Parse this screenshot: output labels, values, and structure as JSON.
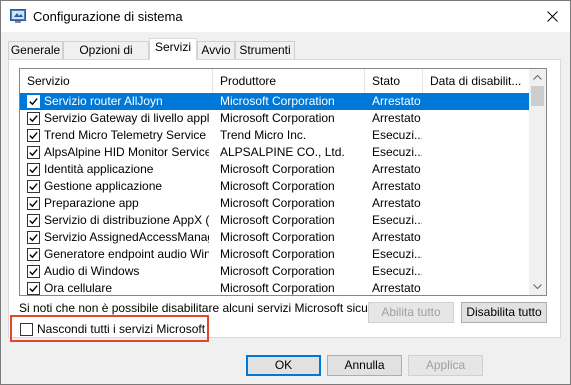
{
  "window": {
    "title": "Configurazione di sistema"
  },
  "tabs": [
    {
      "label": "Generale",
      "active": false
    },
    {
      "label": "Opzioni di avvio",
      "active": false
    },
    {
      "label": "Servizi",
      "active": true
    },
    {
      "label": "Avvio",
      "active": false
    },
    {
      "label": "Strumenti",
      "active": false
    }
  ],
  "table": {
    "columns": [
      "Servizio",
      "Produttore",
      "Stato",
      "Data di disabilit..."
    ],
    "rows": [
      {
        "checked": true,
        "service": "Servizio router AllJoyn",
        "vendor": "Microsoft Corporation",
        "status": "Arrestato",
        "date": "",
        "selected": true
      },
      {
        "checked": true,
        "service": "Servizio Gateway di livello applic...",
        "vendor": "Microsoft Corporation",
        "status": "Arrestato",
        "date": ""
      },
      {
        "checked": true,
        "service": "Trend Micro Telemetry Service",
        "vendor": "Trend Micro Inc.",
        "status": "Esecuzi...",
        "date": ""
      },
      {
        "checked": true,
        "service": "AlpsAlpine HID Monitor Service",
        "vendor": "ALPSALPINE CO., Ltd.",
        "status": "Esecuzi...",
        "date": ""
      },
      {
        "checked": true,
        "service": "Identità applicazione",
        "vendor": "Microsoft Corporation",
        "status": "Arrestato",
        "date": ""
      },
      {
        "checked": true,
        "service": "Gestione applicazione",
        "vendor": "Microsoft Corporation",
        "status": "Arrestato",
        "date": ""
      },
      {
        "checked": true,
        "service": "Preparazione app",
        "vendor": "Microsoft Corporation",
        "status": "Arrestato",
        "date": ""
      },
      {
        "checked": true,
        "service": "Servizio di distribuzione AppX (A...",
        "vendor": "Microsoft Corporation",
        "status": "Esecuzi...",
        "date": ""
      },
      {
        "checked": true,
        "service": "Servizio AssignedAccessManager",
        "vendor": "Microsoft Corporation",
        "status": "Arrestato",
        "date": ""
      },
      {
        "checked": true,
        "service": "Generatore endpoint audio Wind...",
        "vendor": "Microsoft Corporation",
        "status": "Esecuzi...",
        "date": ""
      },
      {
        "checked": true,
        "service": "Audio di Windows",
        "vendor": "Microsoft Corporation",
        "status": "Esecuzi...",
        "date": ""
      },
      {
        "checked": true,
        "service": "Ora cellulare",
        "vendor": "Microsoft Corporation",
        "status": "Arrestato",
        "date": ""
      }
    ]
  },
  "note": "Si noti che non è possibile disabilitare alcuni servizi Microsoft sicuri.",
  "buttons": {
    "enable_all": "Abilita tutto",
    "disable_all": "Disabilita tutto",
    "ok": "OK",
    "cancel": "Annulla",
    "apply": "Applica"
  },
  "hide_ms": {
    "label": "Nascondi tutti i servizi Microsoft",
    "checked": false
  },
  "colors": {
    "selection": "#0078d7",
    "highlight_border": "#e8462a"
  }
}
